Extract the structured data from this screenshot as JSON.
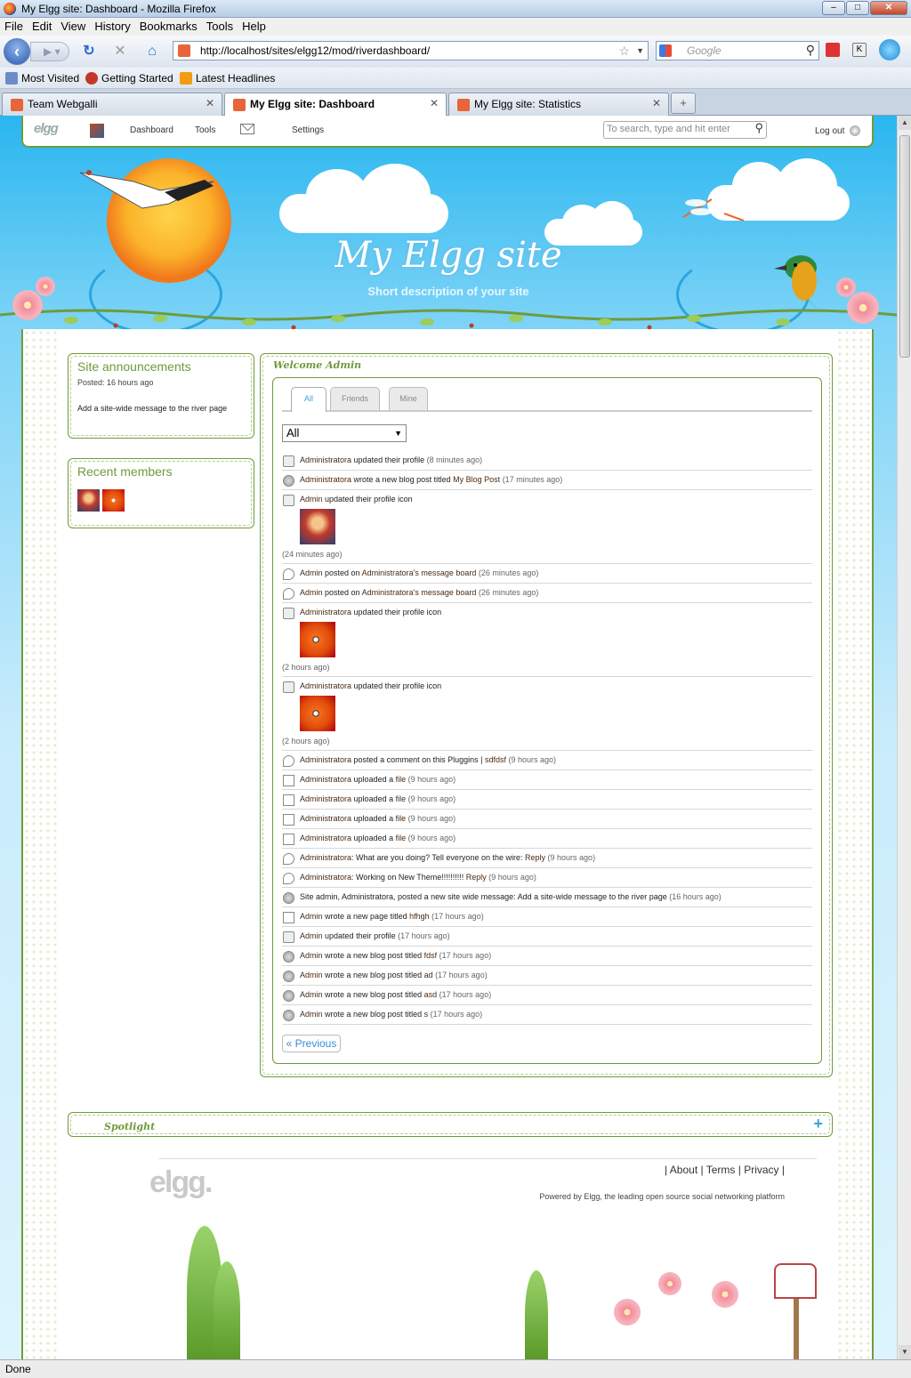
{
  "browser": {
    "window_title": "My Elgg site: Dashboard - Mozilla Firefox",
    "menu": [
      "File",
      "Edit",
      "View",
      "History",
      "Bookmarks",
      "Tools",
      "Help"
    ],
    "url": "http://localhost/sites/elgg12/mod/riverdashboard/",
    "search_placeholder": "Google",
    "bookmarks": [
      "Most Visited",
      "Getting Started",
      "Latest Headlines"
    ],
    "tabs": [
      {
        "label": "Team Webgalli",
        "active": false
      },
      {
        "label": "My Elgg site: Dashboard",
        "active": true
      },
      {
        "label": "My Elgg site: Statistics",
        "active": false
      }
    ],
    "status": "Done"
  },
  "topbar": {
    "logo": "elgg",
    "dashboard": "Dashboard",
    "tools": "Tools",
    "settings": "Settings",
    "search_placeholder": "To search, type and hit enter",
    "logout": "Log out"
  },
  "header": {
    "title": "My Elgg site",
    "description": "Short description of your site"
  },
  "sidebar": {
    "announcements_title": "Site announcements",
    "announcements_posted": "Posted: 16 hours ago",
    "announcements_message": "Add a site-wide message to the river page",
    "members_title": "Recent members"
  },
  "main": {
    "welcome_title": "Welcome Admin",
    "tabs": [
      "All",
      "Friends",
      "Mine"
    ],
    "filter_selected": "All",
    "previous": "« Previous"
  },
  "feed": [
    {
      "icon": "profile",
      "user": "Administratora",
      "text": "updated their profile",
      "time": "(8 minutes ago)"
    },
    {
      "icon": "blog",
      "user": "Administratora",
      "text": "wrote a new blog post titled",
      "link": "My Blog Post",
      "time": "(17 minutes ago)"
    },
    {
      "icon": "profile",
      "user": "Admin",
      "text": "updated their profile icon",
      "time": "(24 minutes ago)",
      "pic": "red"
    },
    {
      "icon": "message",
      "user": "Admin",
      "text": "posted on",
      "link": "Administratora's message board",
      "time": "(26 minutes ago)"
    },
    {
      "icon": "message",
      "user": "Admin",
      "text": "posted on",
      "link": "Administratora's message board",
      "time": "(26 minutes ago)"
    },
    {
      "icon": "profile",
      "user": "Administratora",
      "text": "updated their profile icon",
      "time": "(2 hours ago)",
      "pic": "fish"
    },
    {
      "icon": "profile",
      "user": "Administratora",
      "text": "updated their profile icon",
      "time": "(2 hours ago)",
      "pic": "fish"
    },
    {
      "icon": "message",
      "user": "Administratora",
      "text": "posted a comment on this Pluggins |",
      "link": "sdfdsf",
      "time": "(9 hours ago)"
    },
    {
      "icon": "file",
      "user": "Administratora",
      "text": "uploaded a",
      "link": "file",
      "time": "(9 hours ago)"
    },
    {
      "icon": "file",
      "user": "Administratora",
      "text": "uploaded a",
      "link": "file",
      "time": "(9 hours ago)"
    },
    {
      "icon": "file",
      "user": "Administratora",
      "text": "uploaded a",
      "link": "file",
      "time": "(9 hours ago)"
    },
    {
      "icon": "file",
      "user": "Administratora",
      "text": "uploaded a",
      "link": "file",
      "time": "(9 hours ago)"
    },
    {
      "icon": "wire",
      "user": "Administratora",
      "text": ": What are you doing? Tell everyone on the wire:",
      "link": "Reply",
      "time": "(9 hours ago)"
    },
    {
      "icon": "wire",
      "user": "Administratora",
      "text": ": Working on New Theme!!!!!!!!!!",
      "link": "Reply",
      "time": "(9 hours ago)"
    },
    {
      "icon": "blog",
      "user": "",
      "text": "Site admin, Administratora, posted a new site wide message: Add a site-wide message to the river page",
      "time": "(16 hours ago)"
    },
    {
      "icon": "page",
      "user": "Admin",
      "text": "wrote a new page titled",
      "link": "hfhgh",
      "time": "(17 hours ago)"
    },
    {
      "icon": "profile",
      "user": "Admin",
      "text": "updated their profile",
      "time": "(17 hours ago)"
    },
    {
      "icon": "blog",
      "user": "Admin",
      "text": "wrote a new blog post titled",
      "link": "fdsf",
      "time": "(17 hours ago)"
    },
    {
      "icon": "blog",
      "user": "Admin",
      "text": "wrote a new blog post titled",
      "link": "ad",
      "time": "(17 hours ago)"
    },
    {
      "icon": "blog",
      "user": "Admin",
      "text": "wrote a new blog post titled",
      "link": "asd",
      "time": "(17 hours ago)"
    },
    {
      "icon": "blog",
      "user": "Admin",
      "text": "wrote a new blog post titled",
      "link": "s",
      "time": "(17 hours ago)"
    }
  ],
  "spotlight": {
    "title": "Spotlight",
    "toggle": "+"
  },
  "footer": {
    "links": [
      "About",
      "Terms",
      "Privacy"
    ],
    "powered": "Powered by Elgg, the leading open source social networking platform",
    "logo": "elgg."
  }
}
